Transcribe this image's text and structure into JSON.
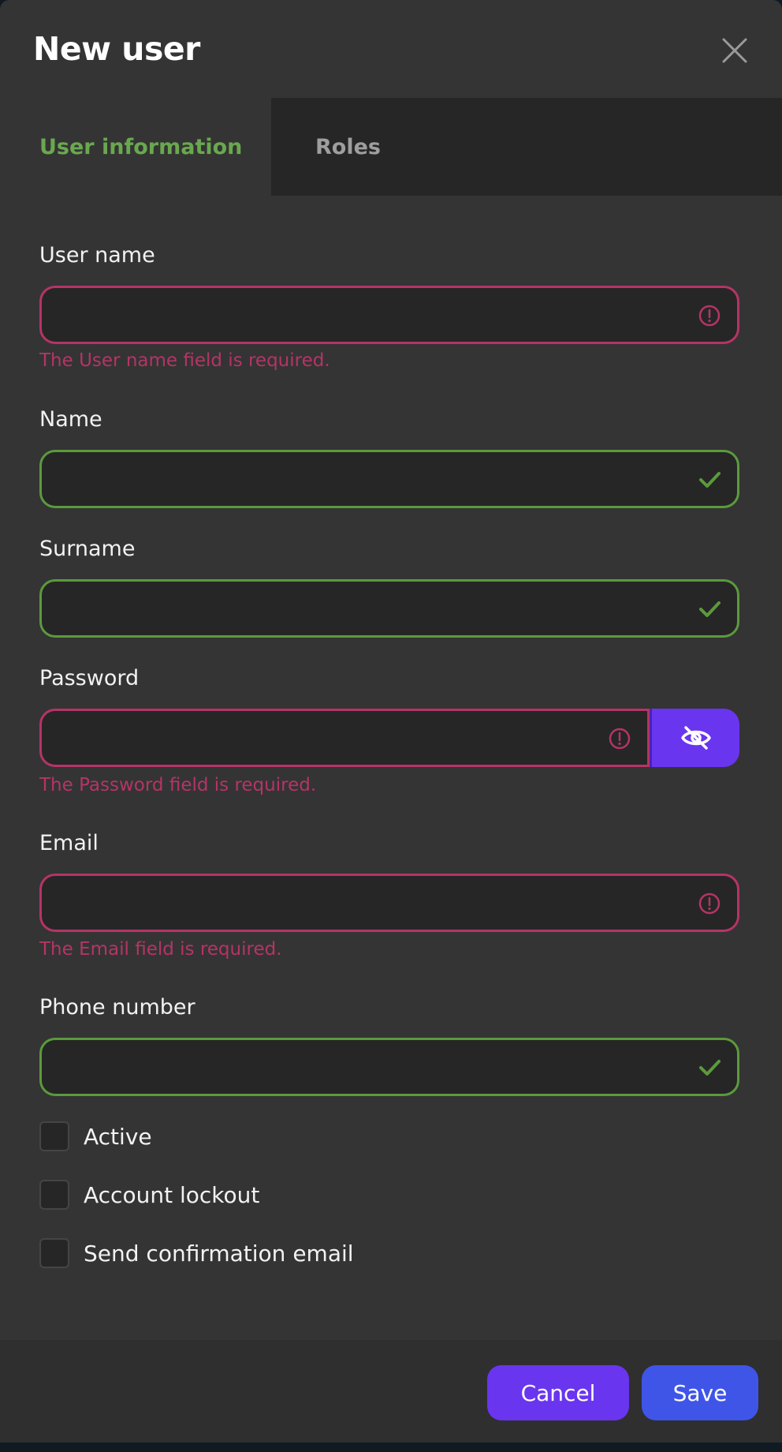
{
  "dialog": {
    "title": "New user"
  },
  "tabs": [
    {
      "label": "User information",
      "active": true
    },
    {
      "label": "Roles",
      "active": false
    }
  ],
  "fields": {
    "user_name": {
      "label": "User name",
      "value": "",
      "error": "The User name field is required."
    },
    "name": {
      "label": "Name",
      "value": ""
    },
    "surname": {
      "label": "Surname",
      "value": ""
    },
    "password": {
      "label": "Password",
      "value": "",
      "error": "The Password field is required."
    },
    "email": {
      "label": "Email",
      "value": "",
      "error": "The Email field is required."
    },
    "phone": {
      "label": "Phone number",
      "value": ""
    }
  },
  "checkboxes": [
    {
      "label": "Active",
      "checked": false
    },
    {
      "label": "Account lockout",
      "checked": false
    },
    {
      "label": "Send confirmation email",
      "checked": false
    }
  ],
  "footer": {
    "cancel_label": "Cancel",
    "save_label": "Save"
  },
  "colors": {
    "accent": "#6a35ef",
    "save": "#3f55e8",
    "valid": "#5b9a3c",
    "invalid": "#b53466",
    "active_tab": "#6aa84f"
  }
}
